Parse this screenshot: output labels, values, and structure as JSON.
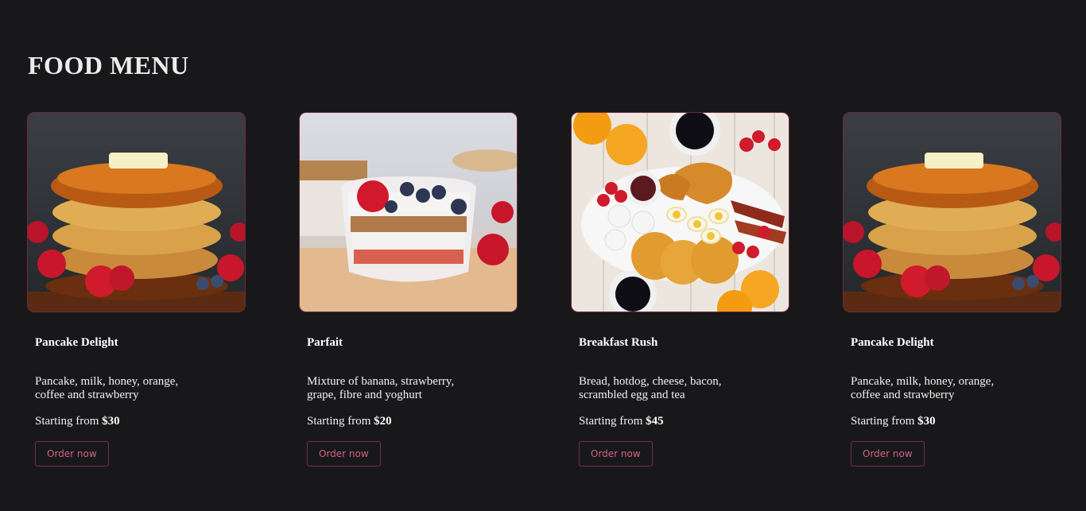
{
  "page": {
    "title": "FOOD MENU"
  },
  "menu": [
    {
      "name": "Pancake Delight",
      "description": "Pancake, milk, honey, orange, coffee and strawberry",
      "price_prefix": "Starting from",
      "price": "$30",
      "button": "Order now",
      "image": "pancake-stack"
    },
    {
      "name": "Parfait",
      "description": "Mixture of banana, strawberry, grape, fibre and yoghurt",
      "price_prefix": "Starting from",
      "price": "$20",
      "button": "Order now",
      "image": "parfait-glass"
    },
    {
      "name": "Breakfast Rush",
      "description": "Bread, hotdog, cheese, bacon, scrambled egg and tea",
      "price_prefix": "Starting from",
      "price": "$45",
      "button": "Order now",
      "image": "breakfast-platter"
    },
    {
      "name": "Pancake Delight",
      "description": "Pancake, milk, honey, orange, coffee and strawberry",
      "price_prefix": "Starting from",
      "price": "$30",
      "button": "Order now",
      "image": "pancake-stack"
    }
  ],
  "colors": {
    "background": "#18181a",
    "accent": "#d06385",
    "border": "#6e2a3e"
  }
}
